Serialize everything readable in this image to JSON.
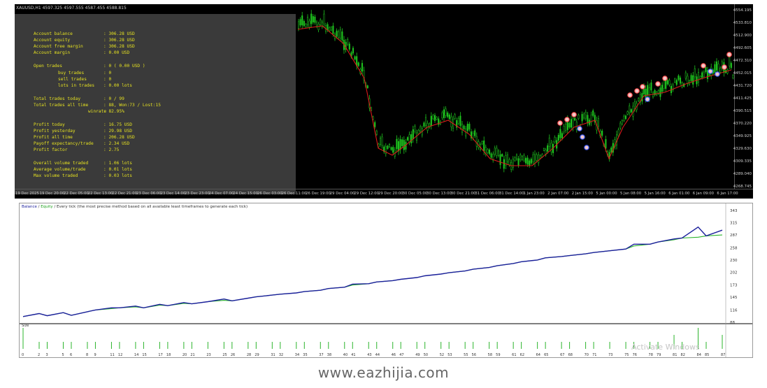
{
  "chart": {
    "title": "XAUUSD,H1  4597.325 4597.555 4587.455 4588.815",
    "price_ticks": [
      "4554.195",
      "4533.810",
      "4512.900",
      "4492.605",
      "4472.310",
      "4452.015",
      "4431.720",
      "4411.425",
      "4390.515",
      "4370.220",
      "4349.925",
      "4329.630",
      "4309.335",
      "4289.040",
      "4268.745"
    ],
    "time_ticks": [
      "19 Dec 2025",
      "19 Dec 20:00",
      "22 Dec 05:00",
      "22 Dec 13:00",
      "22 Dec 21:00",
      "23 Dec 06:00",
      "23 Dec 14:00",
      "23 Dec 23:00",
      "24 Dec 07:00",
      "24 Dec 15:00",
      "26 Dec 03:00",
      "26 Dec 11:00",
      "26 Dec 19:00",
      "29 Dec 04:00",
      "29 Dec 12:00",
      "29 Dec 20:00",
      "30 Dec 05:00",
      "30 Dec 13:00",
      "30 Dec 21:00",
      "31 Dec 06:00",
      "31 Dec 14:00",
      "1 Jan 23:00",
      "2 Jan 07:00",
      "2 Jan 15:00",
      "5 Jan 00:00",
      "5 Jan 08:00",
      "5 Jan 16:00",
      "6 Jan 01:00",
      "6 Jan 09:00",
      "6 Jan 17:00"
    ],
    "colors": {
      "candle": "#1ec41e",
      "ma": "#d81b1b",
      "sell": "#ff4d4d",
      "buy": "#3b5bff"
    }
  },
  "stats": [
    {
      "label": "Account balance",
      "value": ": 306.28 USD"
    },
    {
      "label": "Account equity",
      "value": ": 306.28 USD"
    },
    {
      "label": "Account free margin",
      "value": ": 306.28 USD"
    },
    {
      "label": "Account margin",
      "value": ": 0.00 USD"
    },
    {
      "label": "Open trades",
      "value": ": 0 ( 0.00 USD )"
    },
    {
      "label": "buy trades",
      "value": ": 0"
    },
    {
      "label": "sell trades",
      "value": ": 0"
    },
    {
      "label": "lots in trades",
      "value": ": 0.00 lots"
    },
    {
      "label": "Total trades today",
      "value": ": 0 / 99"
    },
    {
      "label": "Total trades all time",
      "value": ": 88, Won:73 / Lost:15"
    },
    {
      "label": "winrate",
      "value": ": 82.95%"
    },
    {
      "label": "Profit today",
      "value": ": 16.75 USD"
    },
    {
      "label": "Profit yesterday",
      "value": ": 29.98 USD"
    },
    {
      "label": "Profit all time",
      "value": ": 206.28 USD"
    },
    {
      "label": "Payoff expectancy/trade",
      "value": ": 2.34 USD"
    },
    {
      "label": "Profit factor",
      "value": ": 2.75"
    },
    {
      "label": "Overall volume traded",
      "value": ": 1.06 lots"
    },
    {
      "label": "Average volume/trade",
      "value": ": 0.01 lots"
    },
    {
      "label": "Max volume traded",
      "value": ": 0.03 lots"
    }
  ],
  "tester": {
    "header_balance": "Balance",
    "header_equity": "Equity",
    "header_rest": "/ Every tick (the most precise method based on all available least timeframes to generate each tick)",
    "size_label": "Size",
    "y_ticks": [
      "343",
      "315",
      "287",
      "258",
      "230",
      "202",
      "173",
      "145",
      "116",
      "88"
    ],
    "x_ticks": [
      "0",
      "2",
      "3",
      "5",
      "6",
      "8",
      "9",
      "11",
      "12",
      "14",
      "15",
      "17",
      "18",
      "20",
      "21",
      "23",
      "25",
      "26",
      "28",
      "29",
      "31",
      "32",
      "34",
      "35",
      "37",
      "38",
      "40",
      "41",
      "43",
      "44",
      "46",
      "47",
      "49",
      "50",
      "52",
      "53",
      "55",
      "56",
      "58",
      "59",
      "61",
      "62",
      "64",
      "65",
      "67",
      "68",
      "70",
      "71",
      "73",
      "75",
      "76",
      "78",
      "79",
      "81",
      "82",
      "84",
      "85",
      "87"
    ],
    "colors": {
      "balance": "#1b1f9c",
      "equity": "#2bb42b",
      "volume": "#2bb42b"
    },
    "watermark": "Activate Windows"
  },
  "chart_data": {
    "type": "line",
    "title": "",
    "xlabel": "",
    "ylabel": "",
    "ylim": [
      88,
      343
    ],
    "x": [
      0,
      2,
      3,
      5,
      6,
      8,
      9,
      11,
      12,
      14,
      15,
      17,
      18,
      20,
      21,
      23,
      25,
      26,
      28,
      29,
      31,
      32,
      34,
      35,
      37,
      38,
      40,
      41,
      43,
      44,
      46,
      47,
      49,
      50,
      52,
      53,
      55,
      56,
      58,
      59,
      61,
      62,
      64,
      65,
      67,
      68,
      70,
      71,
      73,
      75,
      76,
      78,
      79,
      81,
      82,
      84,
      85,
      87
    ],
    "series": [
      {
        "name": "Balance",
        "values": [
          101,
          108,
          103,
          110,
          104,
          112,
          116,
          119,
          121,
          123,
          121,
          127,
          126,
          131,
          130,
          135,
          138,
          137,
          143,
          146,
          150,
          152,
          155,
          158,
          161,
          165,
          168,
          173,
          176,
          180,
          183,
          186,
          190,
          194,
          198,
          201,
          205,
          209,
          213,
          217,
          222,
          226,
          230,
          235,
          238,
          240,
          244,
          247,
          251,
          255,
          262,
          266,
          271,
          276,
          280,
          282,
          285,
          287
        ]
      },
      {
        "name": "Equity",
        "values": [
          101,
          108,
          103,
          110,
          104,
          112,
          116,
          121,
          121,
          125,
          121,
          129,
          126,
          133,
          130,
          135,
          141,
          137,
          143,
          146,
          150,
          152,
          155,
          158,
          161,
          165,
          168,
          175,
          176,
          180,
          183,
          186,
          190,
          194,
          198,
          201,
          205,
          209,
          213,
          217,
          222,
          226,
          230,
          235,
          238,
          240,
          244,
          247,
          251,
          255,
          266,
          266,
          271,
          278,
          280,
          305,
          285,
          298
        ]
      }
    ],
    "volume": [
      3,
      1,
      1,
      1,
      1,
      1,
      1,
      1,
      1,
      1,
      1,
      1,
      1,
      1,
      1,
      1,
      1,
      1,
      1,
      1,
      1,
      1,
      1,
      1,
      1,
      1,
      1,
      1,
      1,
      1,
      1,
      1,
      1,
      1,
      1,
      1,
      1,
      1,
      1,
      1,
      1,
      1,
      1,
      1,
      1,
      1,
      1,
      1,
      1,
      1,
      1,
      1,
      1,
      2,
      1,
      3,
      1,
      2
    ]
  },
  "footer": {
    "url": "www.eazhijia.com"
  }
}
